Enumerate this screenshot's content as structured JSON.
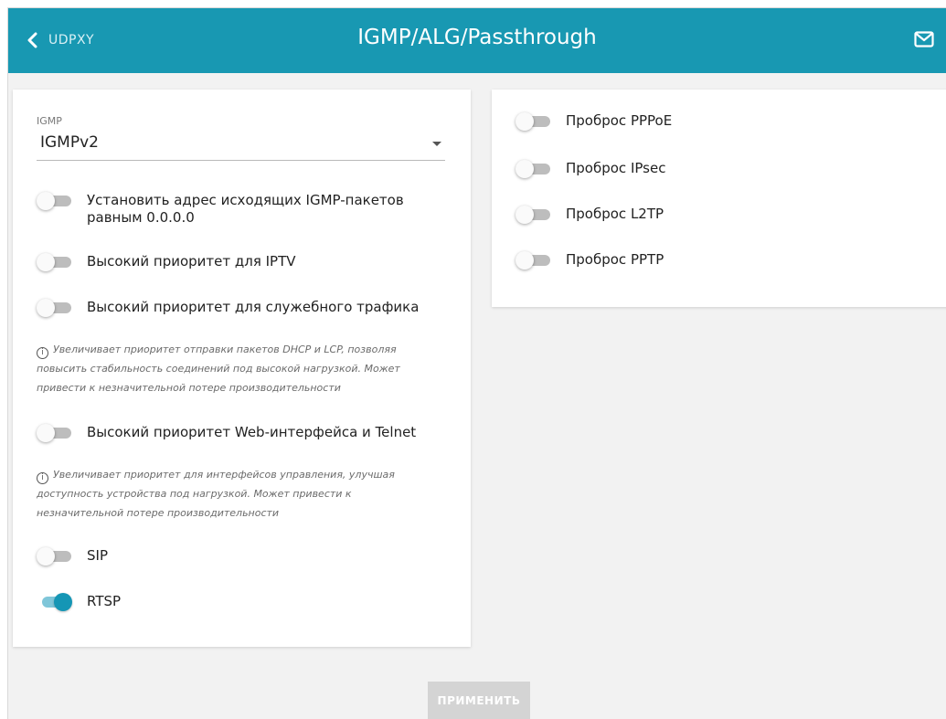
{
  "header": {
    "back_label": "UDPXY",
    "title": "IGMP/ALG/Passthrough",
    "icons": {
      "back": "chevron-left-icon",
      "mail": "mail-icon"
    },
    "bg_color": "#1898b2"
  },
  "igmp": {
    "label": "IGMP",
    "selected": "IGMPv2"
  },
  "left_toggles": {
    "zero_src": {
      "label": "Установить адрес исходящих IGMP-пакетов равным 0.0.0.0",
      "on": false
    },
    "iptv_priority": {
      "label": "Высокий приоритет для IPTV",
      "on": false
    },
    "service_priority": {
      "label": "Высокий приоритет для служебного трафика",
      "on": false
    },
    "web_telnet_priority": {
      "label": "Высокий приоритет Web-интерфейса и Telnet",
      "on": false
    },
    "sip": {
      "label": "SIP",
      "on": false
    },
    "rtsp": {
      "label": "RTSP",
      "on": true
    }
  },
  "hints": {
    "service": "Увеличивает приоритет отправки пакетов DHCP и LCP, позволяя повысить стабильность соединений под высокой нагрузкой. Может привести к незначительной потере производительности",
    "web": "Увеличивает приоритет для интерфейсов управления, улучшая доступность устройства под нагрузкой. Может привести к незначительной потере производительности",
    "icon": "info-icon"
  },
  "right_toggles": {
    "pppoe": {
      "label": "Проброс PPPoE",
      "on": false
    },
    "ipsec": {
      "label": "Проброс IPsec",
      "on": false
    },
    "l2tp": {
      "label": "Проброс L2TP",
      "on": false
    },
    "pptp": {
      "label": "Проброс PPTP",
      "on": false
    }
  },
  "apply_label": "ПРИМЕНИТЬ",
  "colors": {
    "accent": "#1596b5",
    "toggle_on_track": "#7fc6d9",
    "toggle_off_track": "#bdbdbd"
  }
}
